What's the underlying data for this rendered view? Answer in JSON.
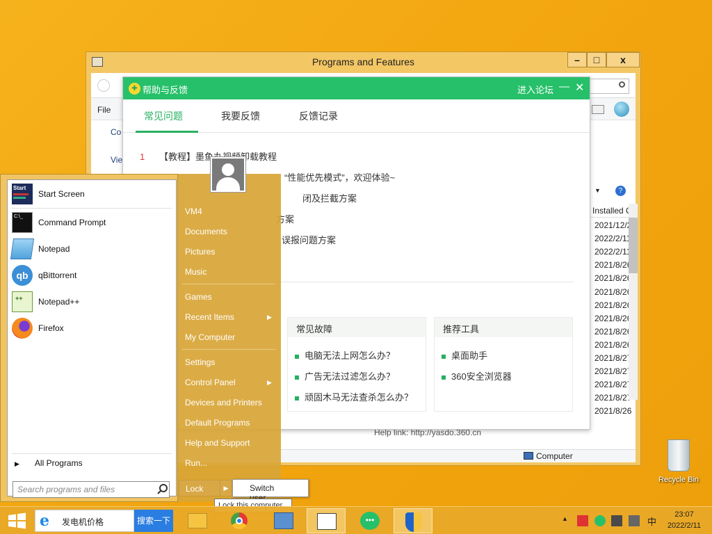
{
  "programs_window": {
    "title": "Programs and Features",
    "search_placeholder": "ures",
    "menu_file": "File",
    "left_links": [
      "Co",
      "Vie"
    ],
    "column_installed": "Installed O",
    "dates": [
      "2021/12/2",
      "2022/2/11",
      "2022/2/11",
      "2021/8/26",
      "2021/8/26",
      "2021/8/26",
      "2021/8/26",
      "2021/8/26",
      "2021/8/26",
      "2021/8/26",
      "2021/8/27",
      "2021/8/27",
      "2021/8/27",
      "2021/8/27",
      "2021/8/26"
    ],
    "status_computer": "Computer",
    "help_link": "Help link:    http://yasdo.360.cn",
    "ctrl_min": "–",
    "ctrl_max": "□",
    "ctrl_close": "x"
  },
  "help_window": {
    "title": "帮助与反馈",
    "forum": "进入论坛",
    "tabs": [
      "常见问题",
      "我要反馈",
      "反馈记录"
    ],
    "faq": [
      {
        "num": "1",
        "text": "【教程】墨鱼丸视频卸载教程"
      },
      {
        "num": "",
        "text": "“性能优先模式”，欢迎体验~"
      },
      {
        "num": "",
        "text": "闭及拦截方案"
      },
      {
        "num": "",
        "text": "方案"
      },
      {
        "num": "",
        "text": "误报问题方案"
      }
    ],
    "faults_title": "常见故障",
    "faults": [
      "电脑无法上网怎么办？",
      "广告无法过滤怎么办？",
      "顽固木马无法查杀怎么办？"
    ],
    "tools_title": "推荐工具",
    "tools": [
      "桌面助手",
      "360安全浏览器"
    ]
  },
  "start_menu": {
    "left_items": [
      {
        "label": "Start Screen",
        "icon": "start-screen-icon"
      },
      {
        "label": "Command Prompt",
        "icon": "command-prompt-icon"
      },
      {
        "label": "Notepad",
        "icon": "notepad-icon"
      },
      {
        "label": "qBittorrent",
        "icon": "qbittorrent-icon"
      },
      {
        "label": "Notepad++",
        "icon": "notepadpp-icon"
      },
      {
        "label": "Firefox",
        "icon": "firefox-icon"
      }
    ],
    "all_programs": "All Programs",
    "search_placeholder": "Search programs and files",
    "right_items": [
      "VM4",
      "Documents",
      "Pictures",
      "Music",
      "Games",
      "Recent Items",
      "My Computer",
      "Settings",
      "Control Panel",
      "Devices and Printers",
      "Default Programs",
      "Help and Support",
      "Run..."
    ],
    "lock": "Lock",
    "switch_user": "Switch user",
    "tooltip": "Lock this computer."
  },
  "desktop": {
    "recycle_bin": "Recycle Bin"
  },
  "taskbar": {
    "ie_text": "发电机价格",
    "search_button": "搜索一下",
    "ime": "中",
    "time": "23:07",
    "date": "2022/2/11"
  }
}
